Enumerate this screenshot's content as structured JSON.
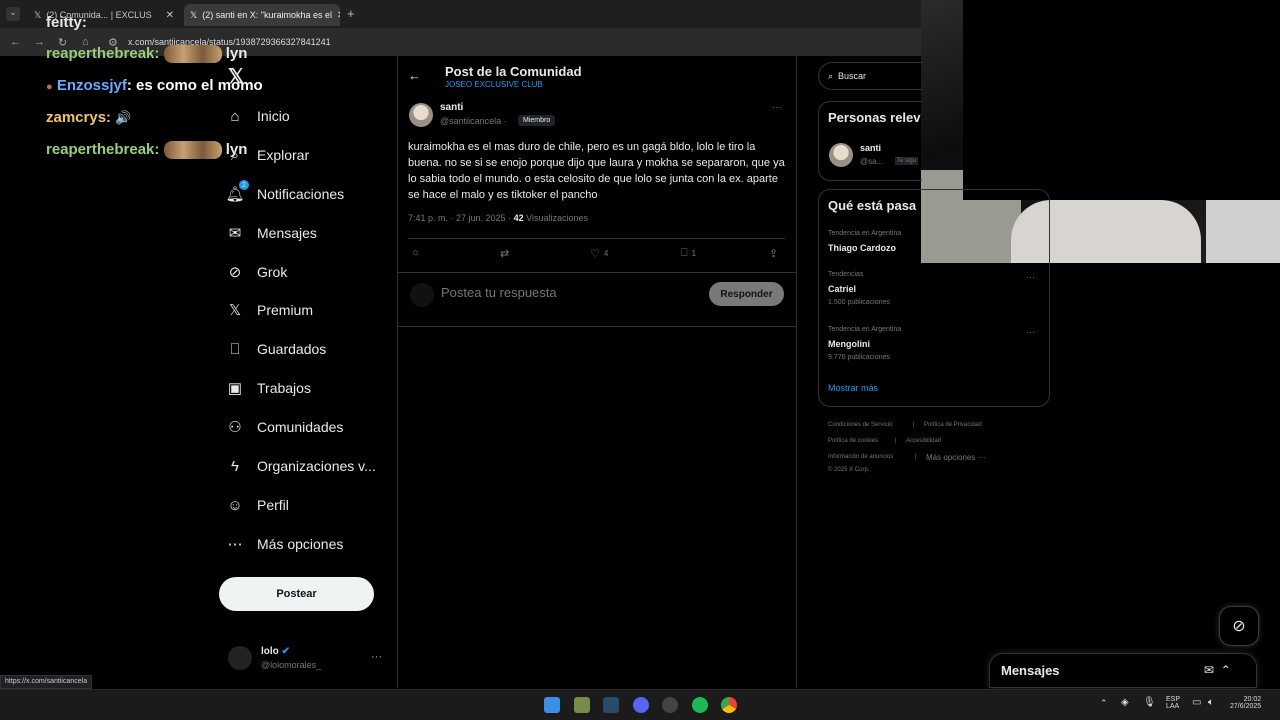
{
  "browser": {
    "tabs": [
      {
        "label": "(2) Comunida... | EXCLUS"
      },
      {
        "label": "(2) santi en X: \"kuraimokha es el"
      }
    ],
    "url": "x.com/santiicancela/status/1938729366327841241",
    "status_url": "https://x.com/santiicancela"
  },
  "chat": [
    {
      "user": "feitty:",
      "color": "#e7e9ea",
      "message": ""
    },
    {
      "user": "reaperthebreak:",
      "color": "#9acd7a",
      "message": "lyn"
    },
    {
      "user": "Enzossjyf",
      "color": "#6fa8ff",
      "message": ": es como el momo"
    },
    {
      "user": "zamcrys:",
      "color": "#f0c36a",
      "message": ""
    },
    {
      "user": "reaperthebreak:",
      "color": "#9acd7a",
      "message": "lyn"
    }
  ],
  "sidebar": {
    "items": [
      {
        "label": "Inicio",
        "icon": "home-icon"
      },
      {
        "label": "Explorar",
        "icon": "search-icon"
      },
      {
        "label": "Notificaciones",
        "icon": "bell-icon",
        "badge": "2"
      },
      {
        "label": "Mensajes",
        "icon": "mail-icon"
      },
      {
        "label": "Grok",
        "icon": "grok-icon"
      },
      {
        "label": "Premium",
        "icon": "x-icon"
      },
      {
        "label": "Guardados",
        "icon": "bookmark-icon"
      },
      {
        "label": "Trabajos",
        "icon": "briefcase-icon"
      },
      {
        "label": "Comunidades",
        "icon": "people-icon"
      },
      {
        "label": "Organizaciones v...",
        "icon": "lightning-icon"
      },
      {
        "label": "Perfil",
        "icon": "person-icon"
      },
      {
        "label": "Más opciones",
        "icon": "more-circle-icon"
      }
    ],
    "post_button": "Postear",
    "account": {
      "name": "lolo",
      "handle": "@lolomorales_"
    }
  },
  "post": {
    "header_title": "Post de la Comunidad",
    "header_sub": "JOSEO EXCLUSIVE CLUB",
    "author_name": "santi",
    "author_handle": "@santiicancela ·",
    "member_badge": "Miembro",
    "text": "kuraimokha es el mas duro de chile, pero es un gagá bldo, lolo le tiro la buena. no se si se enojo porque dijo que laura y mokha se separaron, que ya lo sabia todo el mundo. o esta celosito de que lolo se junta con la ex. aparte se hace el malo y es tiktoker el pancho",
    "time": "7:41 p. m. · 27 jun. 2025 ·",
    "views_count": "42",
    "views_label": "Visualizaciones",
    "likes": "4",
    "bookmarks": "1",
    "reply_placeholder": "Postea tu respuesta",
    "reply_button": "Responder"
  },
  "right": {
    "search_placeholder": "Buscar",
    "relevant_title": "Personas relev",
    "relevant_person": {
      "name": "santi",
      "handle": "@sa...",
      "badge": "Te sigu"
    },
    "trends_title": "Qué está pasa",
    "trends": [
      {
        "context": "Tendencia en Argentina",
        "name": "Thiago Cardozo",
        "count": ""
      },
      {
        "context": "Tendencias",
        "name": "Catriel",
        "count": "1.500 publicaciones"
      },
      {
        "context": "Tendencia en Argentina",
        "name": "Mengolini",
        "count": "9.776 publicaciones"
      }
    ],
    "show_more": "Mostrar más",
    "footer": {
      "l1a": "Condiciones de Servicio",
      "l1b": "Política de Privacidad",
      "l2a": "Política de cookies",
      "l2b": "Accesibilidad",
      "l3a": "Información de anuncios",
      "l3b": "Más opciones ···",
      "copy": "© 2025 X Corp."
    }
  },
  "messages_bar": {
    "title": "Mensajes"
  },
  "taskbar": {
    "lang1": "ESP",
    "lang2": "LAA",
    "time": "20:02",
    "date": "27/6/2025"
  },
  "colors": {
    "accent": "#1d9bf0",
    "background": "#000000",
    "text": "#e7e9ea",
    "muted": "#71767b",
    "border": "#2f3336"
  }
}
